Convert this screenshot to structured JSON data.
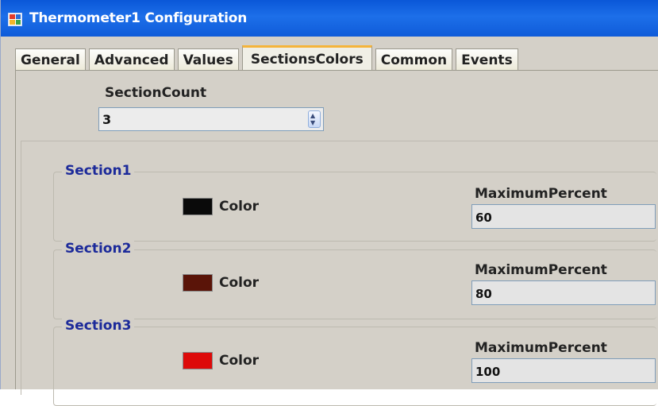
{
  "window": {
    "title": "Thermometer1 Configuration"
  },
  "tabs": [
    {
      "label": "General"
    },
    {
      "label": "Advanced"
    },
    {
      "label": "Values"
    },
    {
      "label": "SectionsColors"
    },
    {
      "label": "Common"
    },
    {
      "label": "Events"
    }
  ],
  "active_tab": "SectionsColors",
  "section_count": {
    "label": "SectionCount",
    "value": "3"
  },
  "sections": [
    {
      "title": "Section1",
      "color_label": "Color",
      "color": "#0a0a0a",
      "max_label": "MaximumPercent",
      "max_value": "60"
    },
    {
      "title": "Section2",
      "color_label": "Color",
      "color": "#5a1408",
      "max_label": "MaximumPercent",
      "max_value": "80"
    },
    {
      "title": "Section3",
      "color_label": "Color",
      "color": "#dd0a0a",
      "max_label": "MaximumPercent",
      "max_value": "100"
    }
  ],
  "colors": {
    "title_bar": "#0a57d8",
    "group_title": "#1c2a9a",
    "active_tab_accent": "#f5b43a",
    "dialog_background": "#d4d0c8"
  },
  "icons": {
    "app": "app-icon",
    "spin_up": "spin-up-icon",
    "spin_down": "spin-down-icon"
  }
}
